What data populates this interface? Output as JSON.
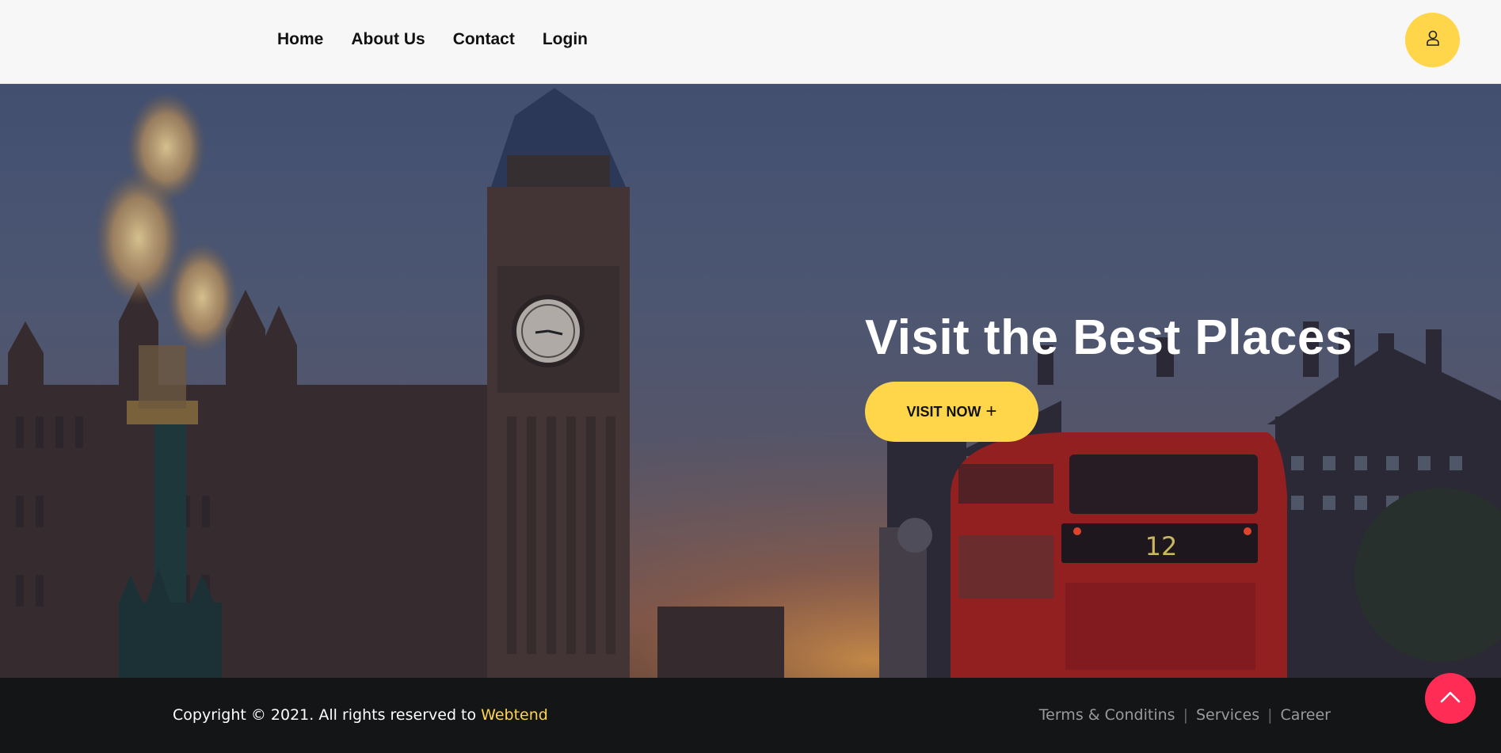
{
  "nav": {
    "items": [
      {
        "label": "Home"
      },
      {
        "label": "About Us"
      },
      {
        "label": "Contact"
      },
      {
        "label": "Login"
      }
    ],
    "user_icon": "user-icon"
  },
  "hero": {
    "title": "Visit the Best Places",
    "cta_label": "VISIT NOW",
    "cta_icon": "plus-icon",
    "bus_number": "12"
  },
  "footer": {
    "copyright_prefix": "Copyright © 2021. All rights reserved to ",
    "brand": "Webtend",
    "links": [
      {
        "label": "Terms & Conditins"
      },
      {
        "label": "Services"
      },
      {
        "label": "Career"
      }
    ],
    "separator": "|"
  },
  "scroll_top": {
    "icon": "chevron-up-icon"
  },
  "colors": {
    "accent": "#ffd54a",
    "scroll_top": "#ff2d55",
    "footer_bg": "#131517",
    "header_bg": "#f7f7f7"
  }
}
